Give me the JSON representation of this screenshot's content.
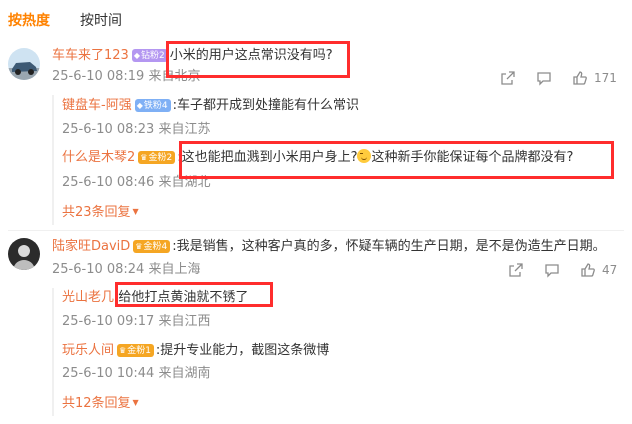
{
  "sort_tabs": {
    "hot": "按热度",
    "time": "按时间"
  },
  "comments": [
    {
      "user": "车车来了123",
      "badge": "钻粉2",
      "text": "小米的用户这点常识没有吗?",
      "time": "25-6-10 08:19",
      "location": "来自北京",
      "likes": "171",
      "replies": [
        {
          "user": "键盘车-阿强",
          "badge": "铁粉4",
          "text": ":车子都开成到处撞能有什么常识",
          "time": "25-6-10 08:23",
          "location": "来自江苏"
        },
        {
          "user": "什么是木琴2",
          "badge": "金粉2",
          "text_before": ":这也能把血溅到小米用户身上?",
          "text_after": "这种新手你能保证每个品牌都没有?",
          "time": "25-6-10 08:46",
          "location": "来自湖北"
        }
      ],
      "more_replies": "共23条回复"
    },
    {
      "user": "陆家旺DaviD",
      "badge": "金粉4",
      "text": ":我是销售，这种客户真的多，怀疑车辆的生产日期，是不是伪造生产日期。",
      "time": "25-6-10 08:24",
      "location": "来自上海",
      "likes": "47",
      "replies": [
        {
          "user": "光山老几",
          "badge": "",
          "text": ":给他打点黄油就不锈了",
          "time": "25-6-10 09:17",
          "location": "来自江西"
        },
        {
          "user": "玩乐人间",
          "badge": "金粉1",
          "text": ":提升专业能力，截图这条微博",
          "time": "25-6-10 10:44",
          "location": "来自湖南"
        }
      ],
      "more_replies": "共12条回复"
    }
  ],
  "colors": {
    "accent": "#ff8200",
    "username": "#eb7340",
    "meta": "#8c8c8c",
    "highlight_box": "#ff2d2d"
  },
  "icons": {
    "share": "share-icon",
    "comment": "comment-icon",
    "like": "thumbs-up-icon",
    "expand": "caret-down-icon"
  }
}
